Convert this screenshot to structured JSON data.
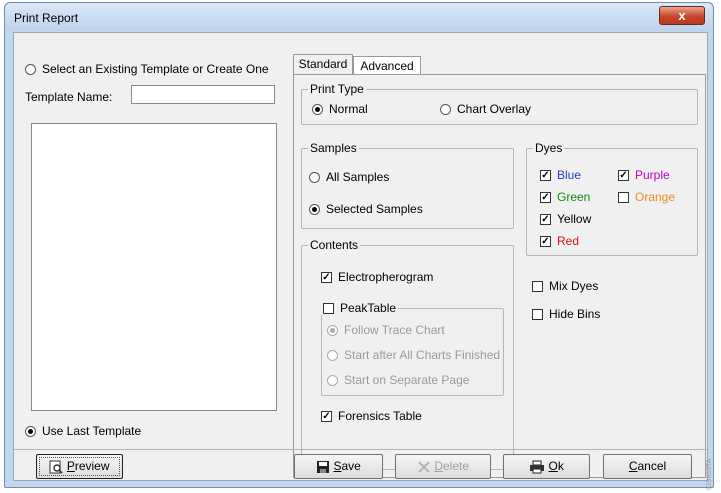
{
  "window": {
    "title": "Print Report",
    "close_label": "x"
  },
  "left": {
    "select_option": "Select an Existing Template or Create One",
    "template_name_label": "Template Name:",
    "template_name_value": "",
    "use_last_template": "Use Last Template"
  },
  "tabs": [
    {
      "label": "Standard"
    },
    {
      "label": "Advanced"
    }
  ],
  "print_type": {
    "title": "Print Type",
    "normal": "Normal",
    "chart_overlay": "Chart Overlay"
  },
  "samples": {
    "title": "Samples",
    "all": "All Samples",
    "selected": "Selected Samples"
  },
  "dyes": {
    "title": "Dyes",
    "items": [
      {
        "label": "Blue",
        "checked": true,
        "color": "#1f3fbf"
      },
      {
        "label": "Purple",
        "checked": true,
        "color": "#c000c0"
      },
      {
        "label": "Green",
        "checked": true,
        "color": "#128a12"
      },
      {
        "label": "Orange",
        "checked": false,
        "color": "#f08a1a"
      },
      {
        "label": "Yellow",
        "checked": true,
        "color": "#000000"
      },
      {
        "label": "Red",
        "checked": true,
        "color": "#e01010"
      }
    ]
  },
  "options": {
    "mix_dyes": "Mix Dyes",
    "hide_bins": "Hide Bins"
  },
  "contents": {
    "title": "Contents",
    "electropherogram": "Electropherogram",
    "peaktable": "PeakTable",
    "follow_trace": "Follow Trace Chart",
    "start_after": "Start after All Charts Finished",
    "start_separate": "Start on Separate Page",
    "forensics_table": "Forensics Table"
  },
  "buttons": {
    "preview_u": "P",
    "preview_rest": "review",
    "save_u": "S",
    "save_rest": "ave",
    "delete_u": "D",
    "delete_rest": "elete",
    "ok_u": "O",
    "ok_rest": "k",
    "cancel_u": "C",
    "cancel_rest": "ancel"
  },
  "watermark": "IG9953TA"
}
